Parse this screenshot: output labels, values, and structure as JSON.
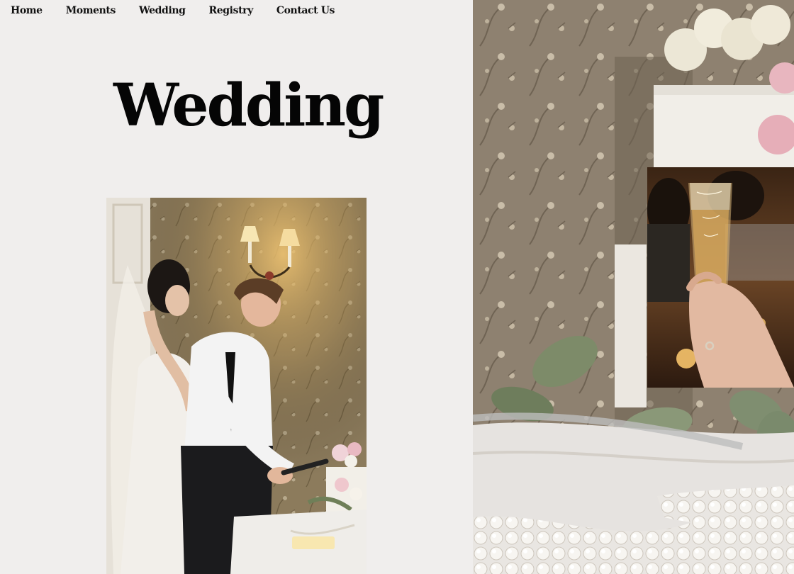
{
  "nav": {
    "items": [
      {
        "label": "Home"
      },
      {
        "label": "Moments"
      },
      {
        "label": "Wedding"
      },
      {
        "label": "Registry"
      },
      {
        "label": "Contact Us"
      }
    ]
  },
  "page": {
    "title": "Wedding"
  },
  "images": {
    "cake_cutting": "photo-bride-groom-cutting-cake",
    "reception_table": "photo-cake-table-with-pearls",
    "champagne_glass": "photo-hand-holding-engraved-champagne-flute"
  },
  "colors": {
    "background": "#f0eeed",
    "text": "#111111"
  }
}
